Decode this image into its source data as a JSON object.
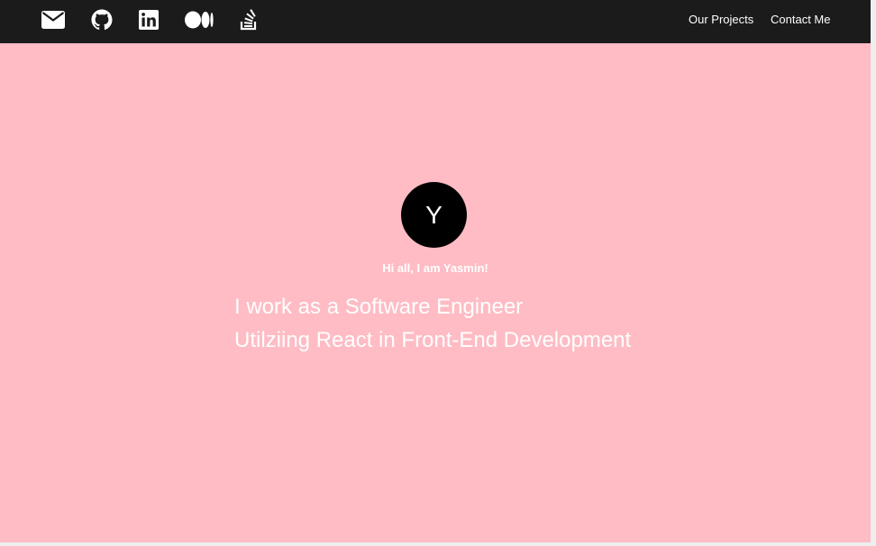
{
  "navbar": {
    "icons": [
      "mail-icon",
      "github-icon",
      "linkedin-icon",
      "medium-icon",
      "stackoverflow-icon"
    ],
    "links": {
      "projects": "Our Projects",
      "contact": "Contact Me"
    }
  },
  "hero": {
    "avatar_letter": "Y",
    "greeting": "Hi all, I am Yasmin!",
    "tagline_line1": "I work as a Software Engineer",
    "tagline_line2": "Utilziing React in Front-End Development"
  },
  "colors": {
    "navbar_bg": "#1b1b1c",
    "page_bg": "#ffbcc4",
    "avatar_bg": "#000000",
    "text": "#ffffff"
  }
}
